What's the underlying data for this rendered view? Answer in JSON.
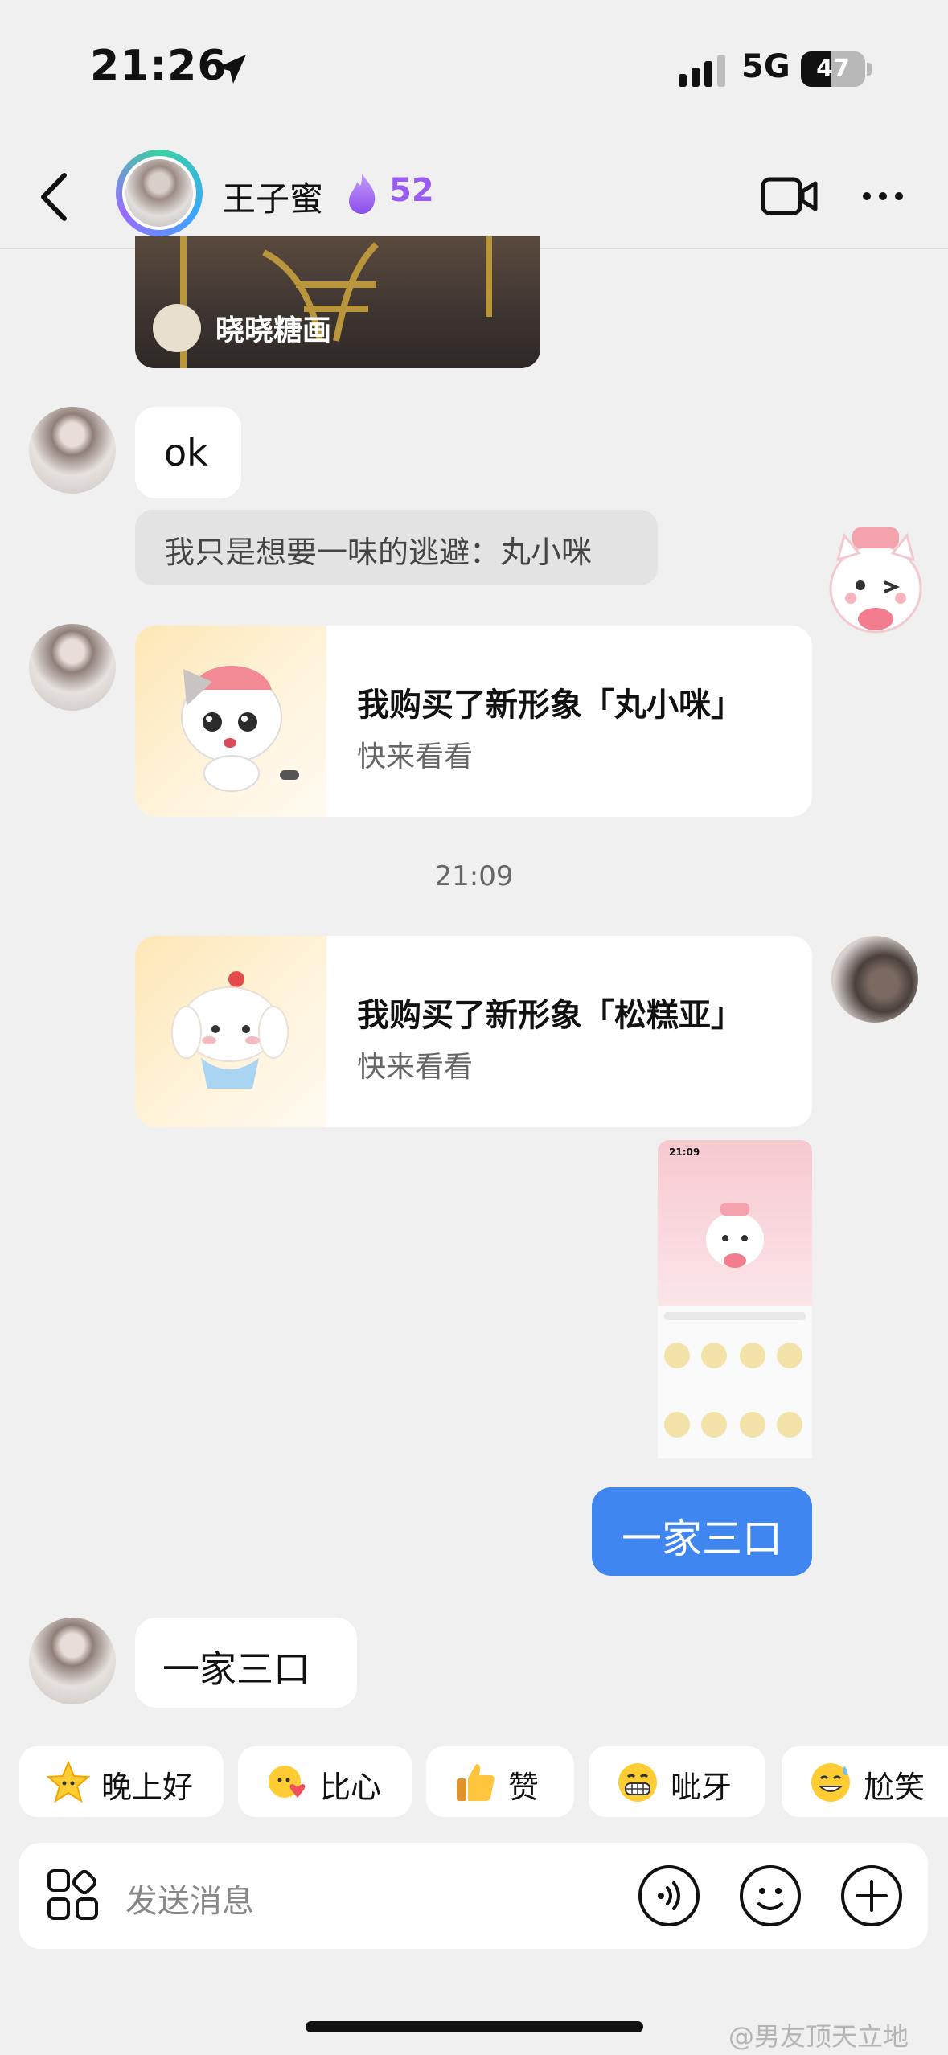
{
  "status_bar": {
    "time": "21:26",
    "network": "5G",
    "battery": "47",
    "battery_level": 0.47
  },
  "header": {
    "contact_name": "王子蜜",
    "streak_count": "52"
  },
  "messages": {
    "image_card_label": "晓晓糖画",
    "text_ok": "ok",
    "system_notice": "我只是想要一味的逃避：丸小咪",
    "card1": {
      "title": "我购买了新形象「丸小咪」",
      "subtitle": "快来看看"
    },
    "timestamp": "21:09",
    "card2": {
      "title": "我购买了新形象「松糕亚」",
      "subtitle": "快来看看"
    },
    "screenshot_time": "21:09",
    "outgoing_text": "一家三口",
    "incoming_text": "一家三口"
  },
  "quick_replies": [
    {
      "icon": "star-face-icon",
      "label": "晚上好"
    },
    {
      "icon": "heart-hands-face-icon",
      "label": "比心"
    },
    {
      "icon": "thumbs-up-icon",
      "label": "赞"
    },
    {
      "icon": "grin-face-icon",
      "label": "呲牙"
    },
    {
      "icon": "awkward-smile-icon",
      "label": "尬笑"
    }
  ],
  "input": {
    "placeholder": "发送消息"
  },
  "watermark": "@男友顶天立地",
  "colors": {
    "accent_blue": "#3f86f0",
    "streak_purple": "#9a5cf0",
    "background": "#f0f0f0"
  }
}
